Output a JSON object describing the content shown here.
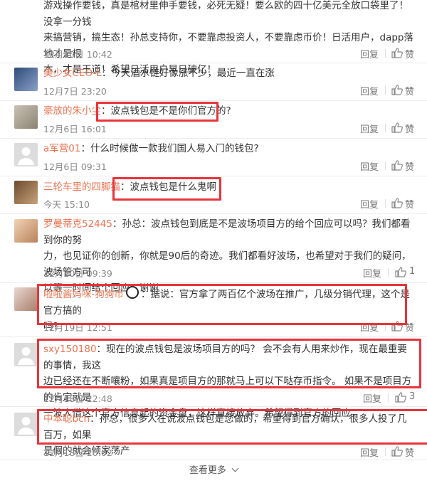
{
  "comments": [
    {
      "name": "",
      "text_lines": [
        "游戏操作要钱，真是棺材里伸手要钱，必死无疑！要么欧的四十亿美元全放口袋里了！没拿一分钱",
        "来搞营销，搞生态！孙总支持你，不要靠虑投资人，不要靠虑币价！日活用户，dapp落地才是根",
        "本，才是王道！希望日活用户早日破亿！"
      ],
      "time": "12月10日 10:42",
      "reply": "回复",
      "like_label": "赞",
      "like_count": ""
    },
    {
      "name": "美少女CEO-L",
      "text": "：今天酒水链好像涨不少，最近一直在涨",
      "time": "12月7日 23:20",
      "reply": "回复",
      "like_label": "赞"
    },
    {
      "name": "豪放的朱小尘",
      "text": "：波点钱包是不是你们官方的?",
      "time": "12月6日 16:01",
      "reply": "回复",
      "like_label": "赞"
    },
    {
      "name": "a军营01",
      "text": "：什么时候做一款我们国人易入门的钱包?",
      "time": "12月6日 09:31",
      "reply": "回复",
      "like_label": "赞"
    },
    {
      "name": "三轮车里的四脚猫",
      "text": "：波点钱包是什么鬼啊",
      "time": "今天 15:10",
      "reply": "回复",
      "like_label": "赞"
    },
    {
      "name": "罗曼蒂克52445",
      "text_lines": [
        "：孙总：波点钱包到底是不是波场项目方的给个回应可以吗？我们都看到你的努",
        "力，也见证你的创新，你就是90后的奇迹。我们都看好波场，也希望对于我们的疑问，波场管方可",
        "以等一时间给个回应，谢谢"
      ],
      "time": "12月20日 09:39",
      "reply": "回复",
      "like_count": "1"
    },
    {
      "name": "啦啦酱妈咪-狗狗币",
      "text_lines": [
        "：据说：官方拿了两百亿个波场在推广，几级分销代理，这个是官方搞的",
        "吗?"
      ],
      "time": "12月19日 12:51",
      "reply": "回复",
      "like_label": "赞"
    },
    {
      "name": "sxy150180",
      "text_lines": [
        "：现在的波点钱包是波场项目方的吗？ 会不会有人用来炒作，现在最重要的事情，我这",
        "边已经还在不断嚷粉，如果真是项目方的那就马上可以下哒存币指令。 如果不是项目方的肯定就是",
        "一波人借这个官方信息起的资金盘，这样直接放弃。希望得到官方的回应。"
      ],
      "time": "12月18日 22:48",
      "reply": "回复",
      "like_count": "3"
    },
    {
      "name": "中本聪bch",
      "text_lines": [
        "：孙总，很多人在说波点钱包是您做的，希望得到官方确认，很多人投了几百万，如果",
        "是假的就会倾家荡产"
      ],
      "time": "12月18日 20:02",
      "reply": "回复",
      "like_label": "赞"
    }
  ],
  "footer": {
    "more_label": "查看更多"
  },
  "colors": {
    "accent": "#eb7350",
    "highlight_box": "#e8343a"
  }
}
